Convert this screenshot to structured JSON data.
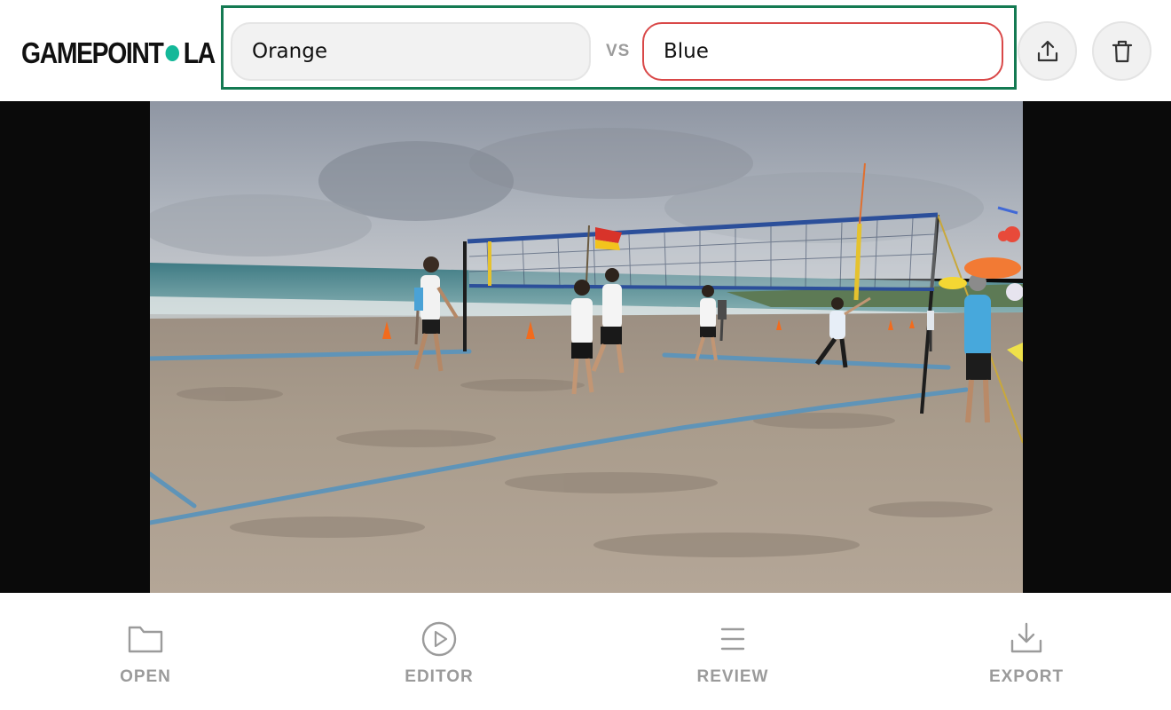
{
  "header": {
    "logo_left": "GAMEPOINT",
    "logo_right": "LA",
    "team_a": {
      "value": "Orange"
    },
    "team_b": {
      "value": "Blue"
    },
    "vs_label": "VS",
    "actions": [
      {
        "icon": "upload-icon"
      },
      {
        "icon": "trash-icon"
      }
    ]
  },
  "viewer": {
    "content": "video-frame"
  },
  "nav": {
    "open": {
      "label": "OPEN",
      "icon": "folder-icon"
    },
    "editor": {
      "label": "EDITOR",
      "icon": "play-circle-icon"
    },
    "review": {
      "label": "REVIEW",
      "icon": "list-icon"
    },
    "export": {
      "label": "EXPORT",
      "icon": "download-icon"
    }
  },
  "colors": {
    "accent": "#14b899",
    "frame": "#147a52",
    "team_b_border": "#d94848",
    "muted": "#9b9b9b"
  }
}
